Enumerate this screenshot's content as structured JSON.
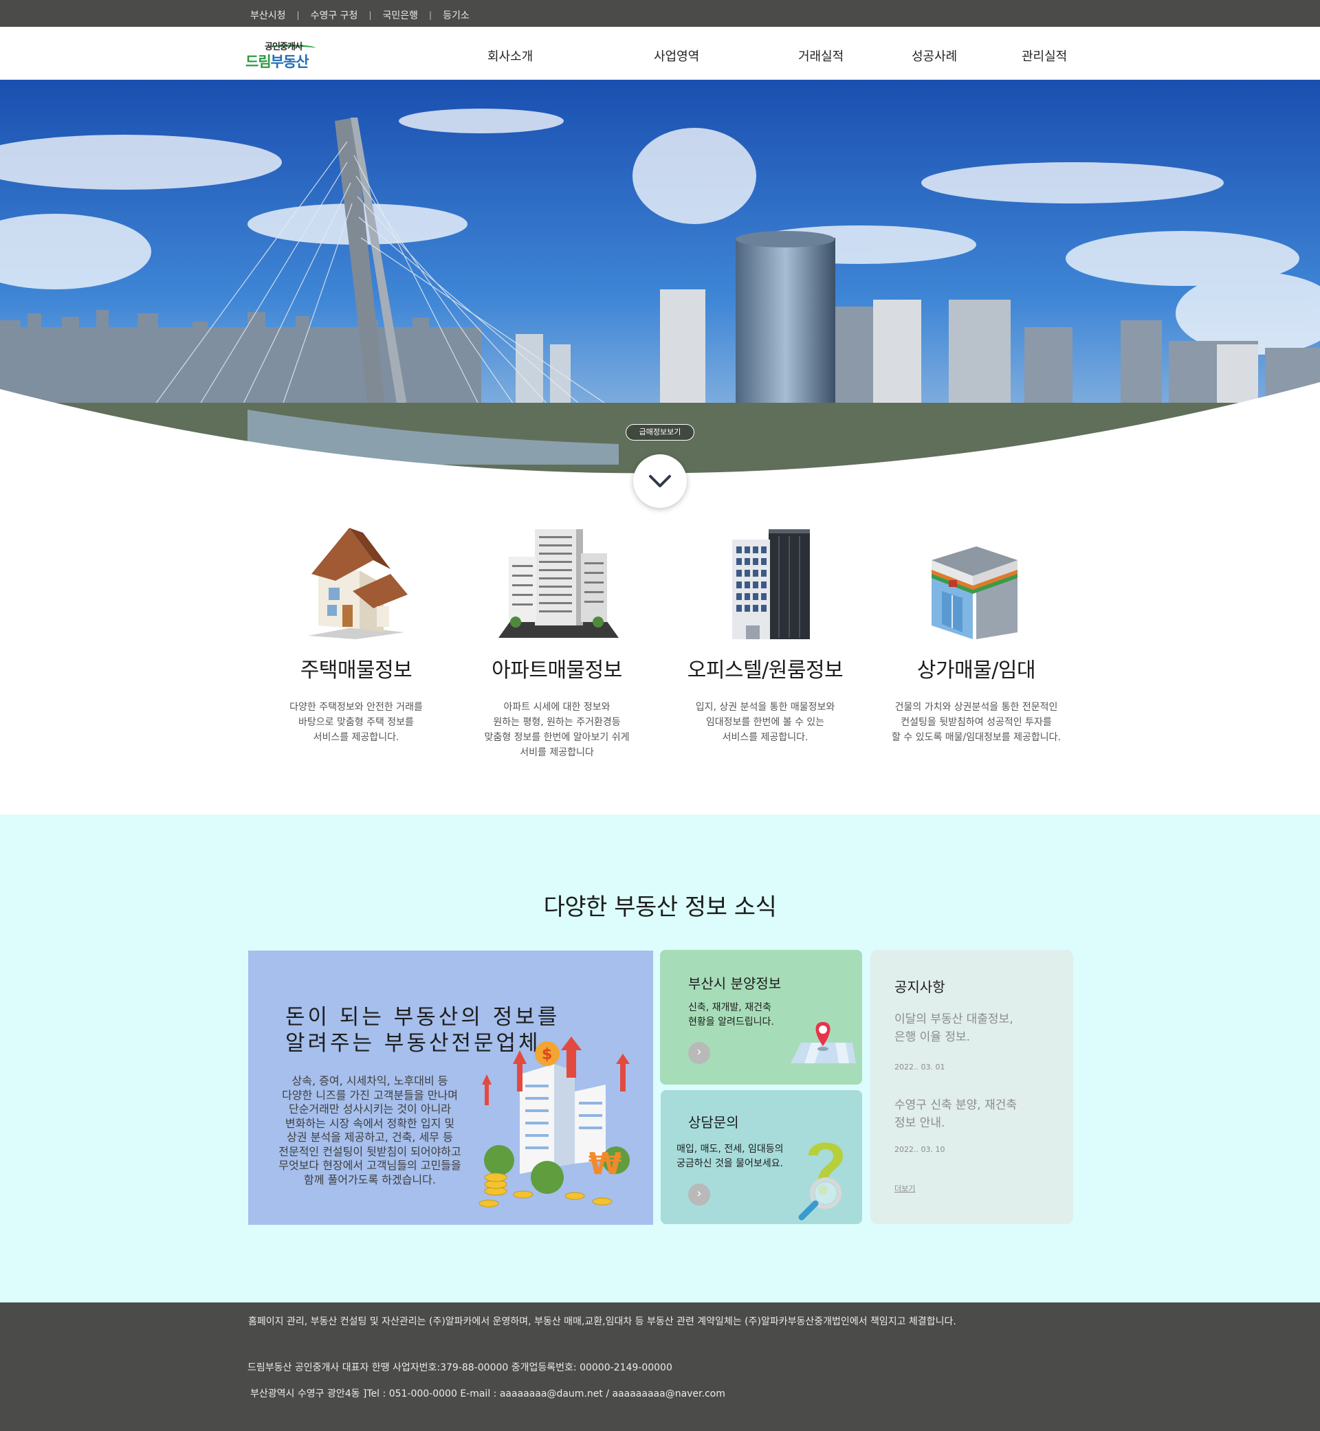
{
  "topbar": {
    "links": [
      "부산시청",
      "수영구 구청",
      "국민은행",
      "등기소"
    ],
    "separator": "|"
  },
  "logo": {
    "top": "공인중개사",
    "main_green": "드림",
    "main_blue": "부동산"
  },
  "nav": {
    "items": [
      "회사소개",
      "사업영역",
      "거래실적",
      "성공사례",
      "관리실적"
    ]
  },
  "hero": {
    "button_label": "급매정보보기",
    "scroll_icon": "chevron-down-icon"
  },
  "services": [
    {
      "title": "주택매물정보",
      "desc": "다양한 주택정보와 안전한 거래를\n바탕으로 맞춤형 주택 정보를\n서비스를 제공합니다.",
      "icon": "house-icon"
    },
    {
      "title": "아파트매물정보",
      "desc": "아파트 시세에 대한 정보와\n원하는 평형, 원하는 주거환경등\n맞춤형 정보를 한번에 알아보기 쉬게\n서비를 제공합니다",
      "icon": "apartment-icon"
    },
    {
      "title": "오피스텔/원룸정보",
      "desc": "입지, 상권 분석을 통한 매물정보와\n임대정보를 한번에 볼 수 있는\n서비스를 제공합니다.",
      "icon": "office-building-icon"
    },
    {
      "title": "상가매물/임대",
      "desc": "건물의 가치와 상권분석을 통한 전문적인\n컨설팅을 뒷받침하여 성공적인 투자를\n할 수 있도록 매물/임대정보를 제공합니다.",
      "icon": "store-icon"
    }
  ],
  "news": {
    "title": "다양한 부동산 정보 소식",
    "main_card": {
      "headline": "돈이 되는 부동산의 정보를\n알려주는  부동산전문업체",
      "body": "상속, 증여, 시세차익, 노후대비 등\n다양한 니즈를 가진 고객분들을 만나며\n단순거래만 성사시키는 것이 아니라\n변화하는 시장 속에서 정확한 입지 및\n상권 분석을 제공하고, 건축, 세무 등\n전문적인 컨설팅이 뒷받침이 되어야하고\n무엇보다 현장에서 고객님들의 고민들을\n함께 풀어가도록 하겠습니다."
    },
    "sale_card": {
      "title": "부산시 분양정보",
      "desc": "신축, 재개발, 재건축\n현황을 알려드립니다.",
      "more": "›",
      "icon": "map-pin-icon"
    },
    "consult_card": {
      "title": "상담문의",
      "desc": "매입, 매도, 전세, 임대등의\n궁금하신 것을 물어보세요.",
      "more": "›",
      "icon": "question-magnifier-icon"
    },
    "notice": {
      "title": "공지사항",
      "items": [
        {
          "text": "이달의 부동산 대출정보,\n은행 이율 정보.",
          "date": "2022.. 03. 01"
        },
        {
          "text": "수영구 신축 분양, 재건축\n정보 안내.",
          "date": "2022.. 03. 10"
        }
      ],
      "more": "더보기"
    }
  },
  "footer": {
    "line1": "홈페이지 관리, 부동산 컨설팅 및 자산관리는 (주)알파카에서 운영하며, 부동산 매매,교환,임대차 등 부동산 관련 계약일체는 (주)알파카부동산중개법인에서 책임지고 체결합니다.",
    "line2": "드림부동산 공인중개사 대표자 한땡   사업자번호:379-88-00000   중개업등록번호: 00000-2149-00000",
    "line3": "부산광역시 수영구 광안4동  ]Tel : 051-000-0000  E-mail : aaaaaaaa@daum.net / aaaaaaaaa@naver.com"
  }
}
